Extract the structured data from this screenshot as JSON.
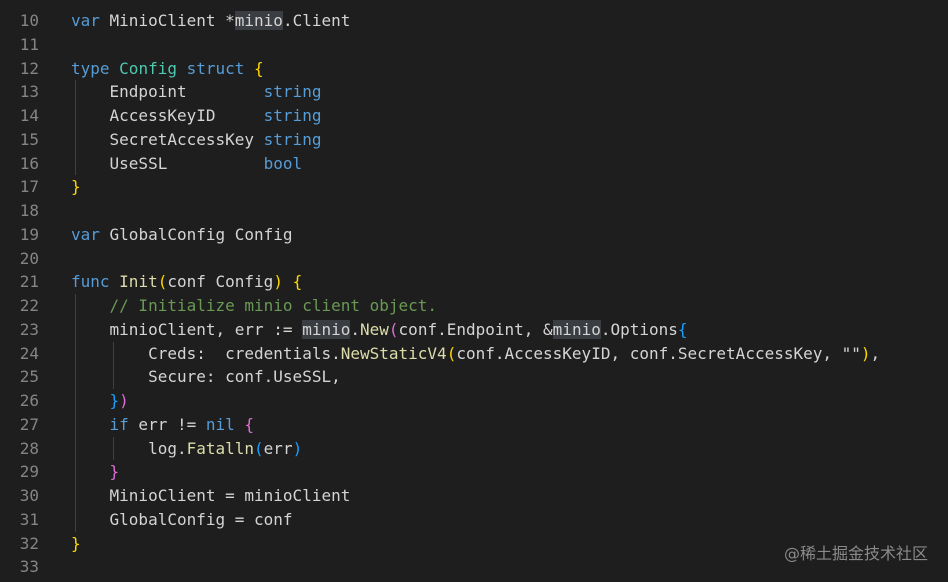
{
  "editor": {
    "lines": [
      {
        "number": "10",
        "tokens": [
          {
            "t": "var",
            "c": "kw"
          },
          {
            "t": " MinioClient *",
            "c": "plain"
          },
          {
            "t": "minio",
            "c": "hl"
          },
          {
            "t": ".Client",
            "c": "plain"
          }
        ]
      },
      {
        "number": "11",
        "tokens": []
      },
      {
        "number": "12",
        "tokens": [
          {
            "t": "type",
            "c": "kw"
          },
          {
            "t": " ",
            "c": "plain"
          },
          {
            "t": "Config",
            "c": "ty"
          },
          {
            "t": " ",
            "c": "plain"
          },
          {
            "t": "struct",
            "c": "kw"
          },
          {
            "t": " ",
            "c": "plain"
          },
          {
            "t": "{",
            "c": "br1"
          }
        ]
      },
      {
        "number": "13",
        "indent": 1,
        "tokens": [
          {
            "t": "    Endpoint        ",
            "c": "plain"
          },
          {
            "t": "string",
            "c": "kw"
          }
        ]
      },
      {
        "number": "14",
        "indent": 1,
        "tokens": [
          {
            "t": "    AccessKeyID     ",
            "c": "plain"
          },
          {
            "t": "string",
            "c": "kw"
          }
        ]
      },
      {
        "number": "15",
        "indent": 1,
        "tokens": [
          {
            "t": "    SecretAccessKey ",
            "c": "plain"
          },
          {
            "t": "string",
            "c": "kw"
          }
        ]
      },
      {
        "number": "16",
        "indent": 1,
        "tokens": [
          {
            "t": "    UseSSL          ",
            "c": "plain"
          },
          {
            "t": "bool",
            "c": "kw"
          }
        ]
      },
      {
        "number": "17",
        "tokens": [
          {
            "t": "}",
            "c": "br1"
          }
        ]
      },
      {
        "number": "18",
        "tokens": []
      },
      {
        "number": "19",
        "tokens": [
          {
            "t": "var",
            "c": "kw"
          },
          {
            "t": " GlobalConfig Config",
            "c": "plain"
          }
        ]
      },
      {
        "number": "20",
        "tokens": []
      },
      {
        "number": "21",
        "tokens": [
          {
            "t": "func",
            "c": "kw"
          },
          {
            "t": " ",
            "c": "plain"
          },
          {
            "t": "Init",
            "c": "fn"
          },
          {
            "t": "(",
            "c": "br1"
          },
          {
            "t": "conf Config",
            "c": "plain"
          },
          {
            "t": ")",
            "c": "br1"
          },
          {
            "t": " ",
            "c": "plain"
          },
          {
            "t": "{",
            "c": "br1"
          }
        ]
      },
      {
        "number": "22",
        "indent": 1,
        "tokens": [
          {
            "t": "    ",
            "c": "plain"
          },
          {
            "t": "// Initialize minio client object.",
            "c": "cm"
          }
        ]
      },
      {
        "number": "23",
        "indent": 1,
        "tokens": [
          {
            "t": "    minioClient, err := ",
            "c": "plain"
          },
          {
            "t": "minio",
            "c": "hl"
          },
          {
            "t": ".",
            "c": "plain"
          },
          {
            "t": "New",
            "c": "fn"
          },
          {
            "t": "(",
            "c": "br2"
          },
          {
            "t": "conf.Endpoint, &",
            "c": "plain"
          },
          {
            "t": "minio",
            "c": "hl"
          },
          {
            "t": ".Options",
            "c": "plain"
          },
          {
            "t": "{",
            "c": "br3"
          }
        ]
      },
      {
        "number": "24",
        "indent": 2,
        "tokens": [
          {
            "t": "        Creds:  credentials.",
            "c": "plain"
          },
          {
            "t": "NewStaticV4",
            "c": "fn"
          },
          {
            "t": "(",
            "c": "br1"
          },
          {
            "t": "conf.AccessKeyID, conf.SecretAccessKey, \"\"",
            "c": "plain"
          },
          {
            "t": ")",
            "c": "br1"
          },
          {
            "t": ",",
            "c": "plain"
          }
        ]
      },
      {
        "number": "25",
        "indent": 2,
        "tokens": [
          {
            "t": "        Secure: conf.UseSSL,",
            "c": "plain"
          }
        ]
      },
      {
        "number": "26",
        "indent": 1,
        "tokens": [
          {
            "t": "    ",
            "c": "plain"
          },
          {
            "t": "}",
            "c": "br3"
          },
          {
            "t": ")",
            "c": "br2"
          }
        ]
      },
      {
        "number": "27",
        "indent": 1,
        "tokens": [
          {
            "t": "    ",
            "c": "plain"
          },
          {
            "t": "if",
            "c": "kw"
          },
          {
            "t": " err != ",
            "c": "plain"
          },
          {
            "t": "nil",
            "c": "kw"
          },
          {
            "t": " ",
            "c": "plain"
          },
          {
            "t": "{",
            "c": "br2"
          }
        ]
      },
      {
        "number": "28",
        "indent": 2,
        "tokens": [
          {
            "t": "        log.",
            "c": "plain"
          },
          {
            "t": "Fatalln",
            "c": "fn"
          },
          {
            "t": "(",
            "c": "br3"
          },
          {
            "t": "err",
            "c": "plain"
          },
          {
            "t": ")",
            "c": "br3"
          }
        ]
      },
      {
        "number": "29",
        "indent": 1,
        "tokens": [
          {
            "t": "    ",
            "c": "plain"
          },
          {
            "t": "}",
            "c": "br2"
          }
        ]
      },
      {
        "number": "30",
        "indent": 1,
        "tokens": [
          {
            "t": "    MinioClient = minioClient",
            "c": "plain"
          }
        ]
      },
      {
        "number": "31",
        "indent": 1,
        "tokens": [
          {
            "t": "    GlobalConfig = conf",
            "c": "plain"
          }
        ]
      },
      {
        "number": "32",
        "tokens": [
          {
            "t": "}",
            "c": "br1"
          }
        ]
      },
      {
        "number": "33",
        "tokens": []
      }
    ]
  },
  "watermark": "@稀土掘金技术社区"
}
